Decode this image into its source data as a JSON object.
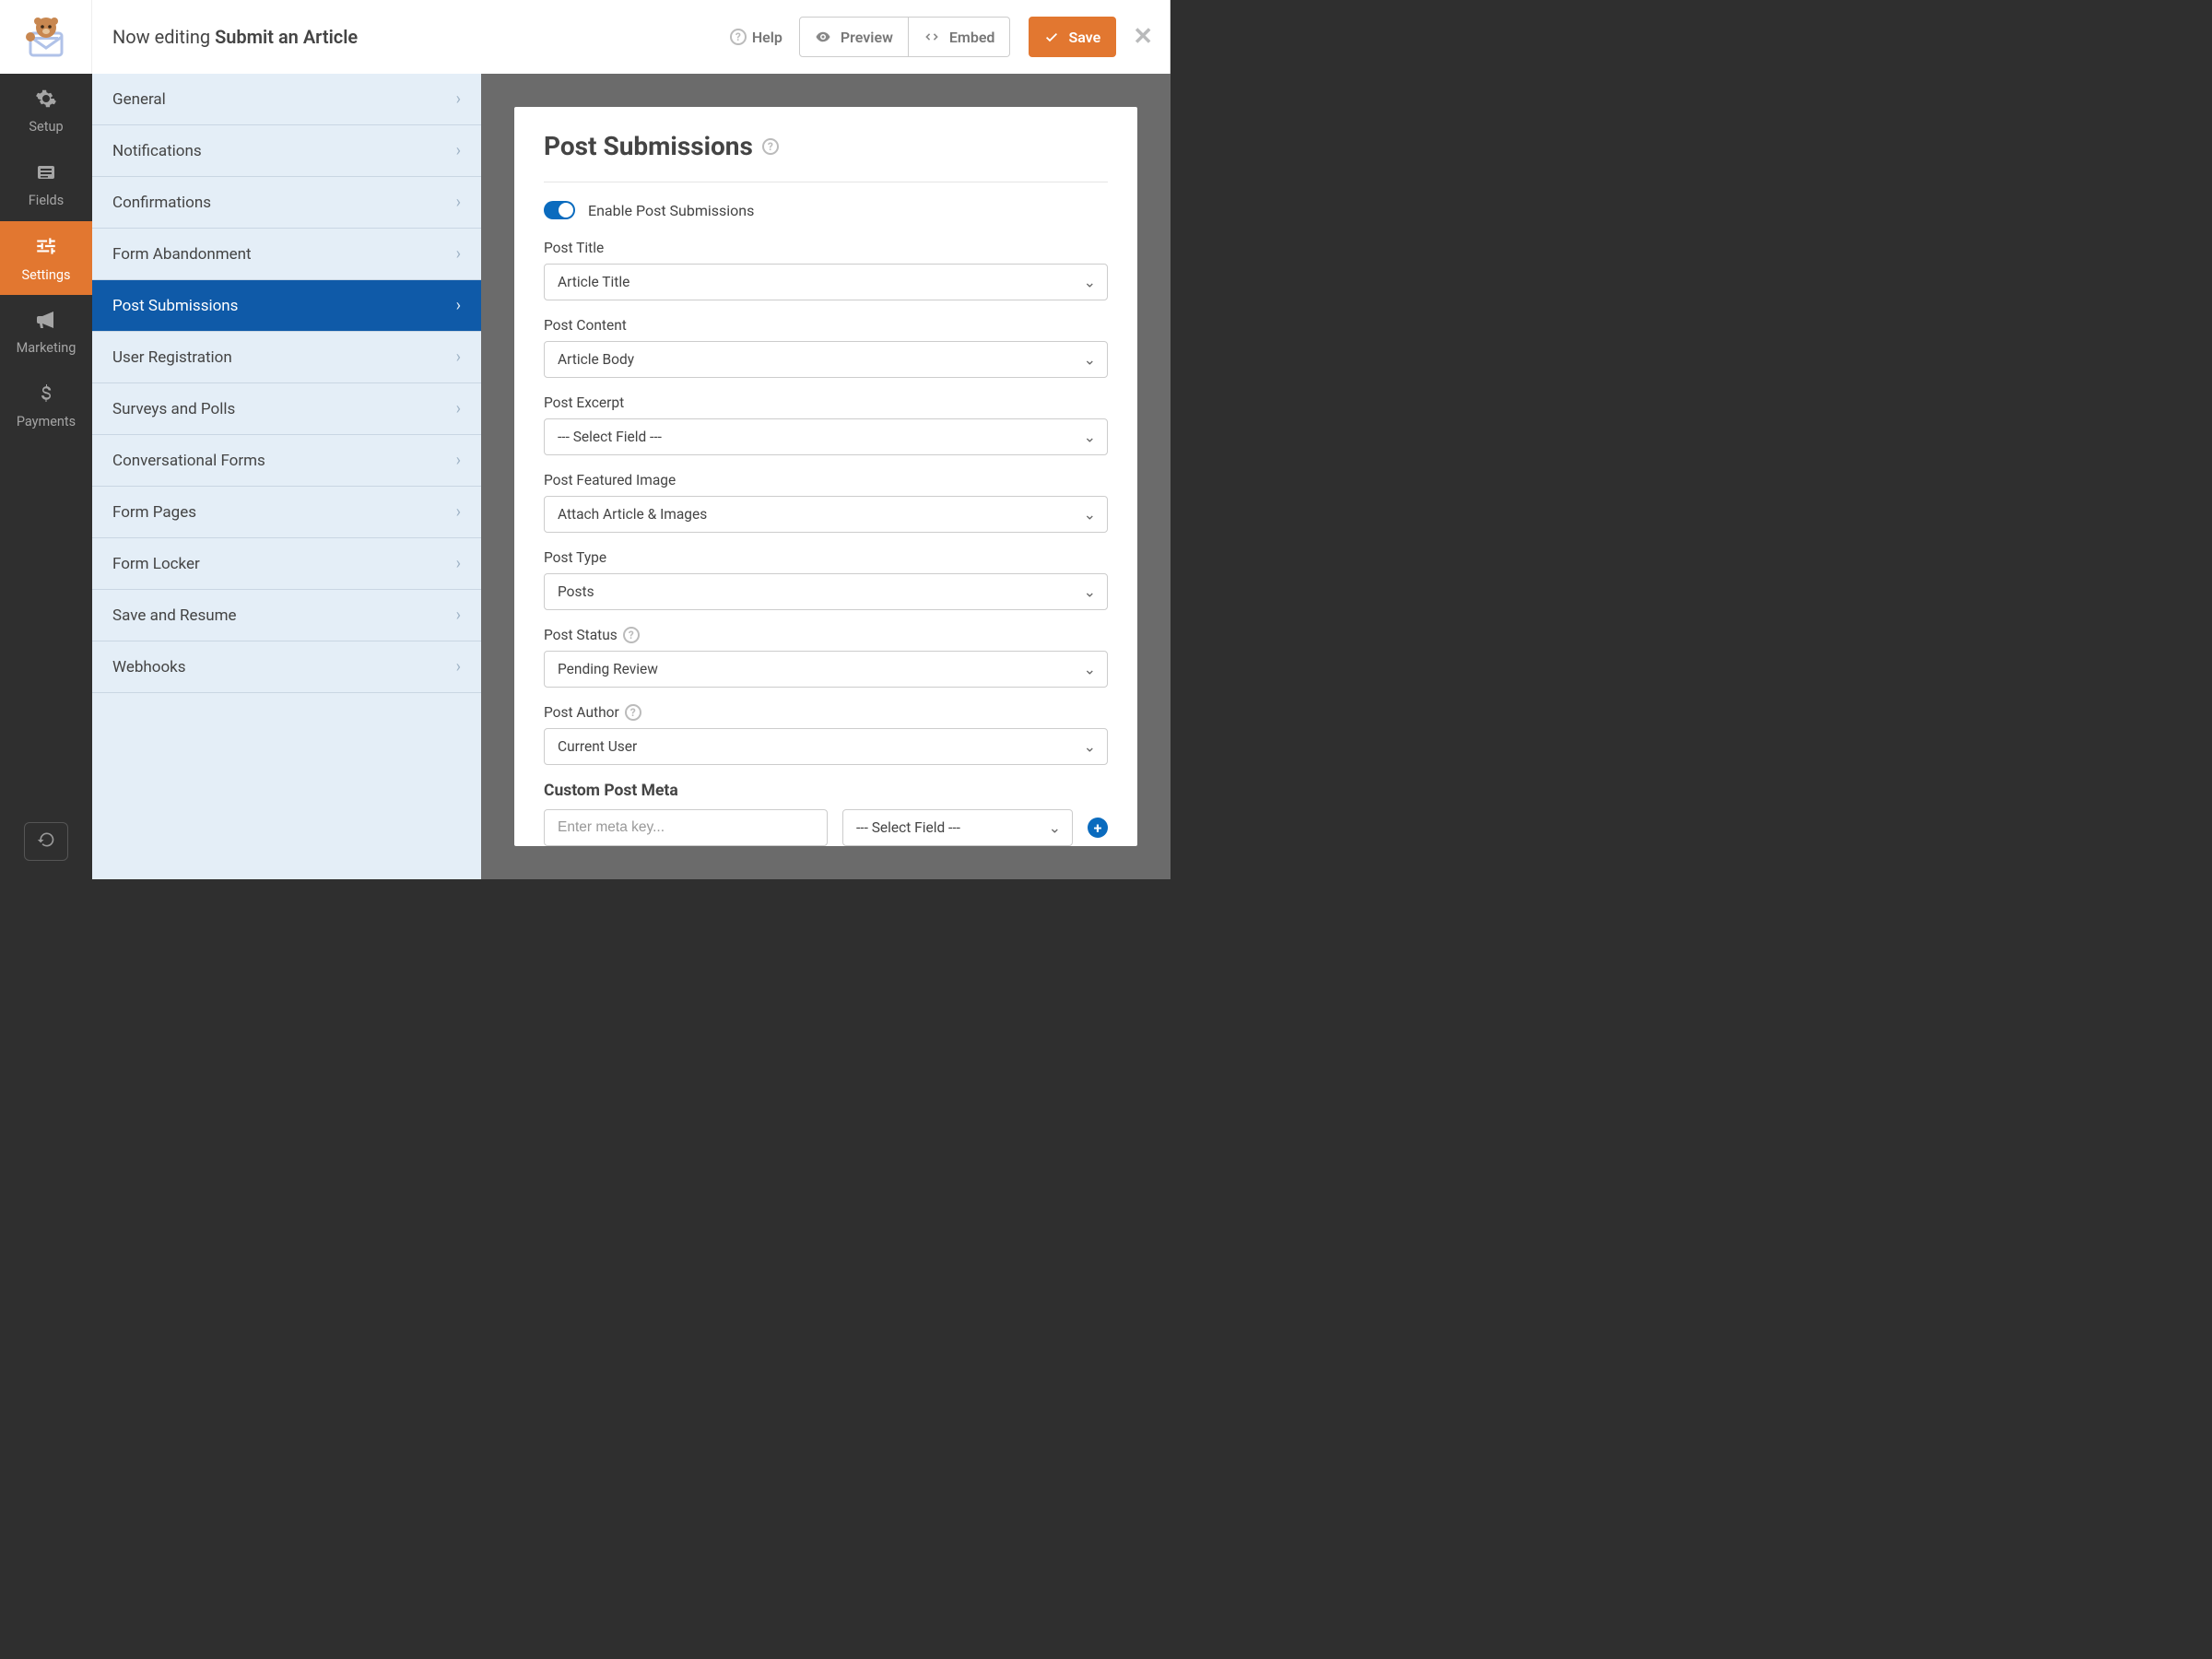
{
  "header": {
    "editing_prefix": "Now editing ",
    "form_title": "Submit an Article",
    "help": "Help",
    "preview": "Preview",
    "embed": "Embed",
    "save": "Save"
  },
  "leftnav": {
    "items": [
      {
        "label": "Setup"
      },
      {
        "label": "Fields"
      },
      {
        "label": "Settings"
      },
      {
        "label": "Marketing"
      },
      {
        "label": "Payments"
      }
    ],
    "active_index": 2
  },
  "settings_menu": {
    "items": [
      "General",
      "Notifications",
      "Confirmations",
      "Form Abandonment",
      "Post Submissions",
      "User Registration",
      "Surveys and Polls",
      "Conversational Forms",
      "Form Pages",
      "Form Locker",
      "Save and Resume",
      "Webhooks"
    ],
    "active_index": 4
  },
  "panel": {
    "title": "Post Submissions",
    "toggle_label": "Enable Post Submissions",
    "toggle_on": true,
    "fields": [
      {
        "label": "Post Title",
        "value": "Article Title",
        "help": false
      },
      {
        "label": "Post Content",
        "value": "Article Body",
        "help": false
      },
      {
        "label": "Post Excerpt",
        "value": "--- Select Field ---",
        "help": false
      },
      {
        "label": "Post Featured Image",
        "value": "Attach Article & Images",
        "help": false
      },
      {
        "label": "Post Type",
        "value": "Posts",
        "help": false
      },
      {
        "label": "Post Status",
        "value": "Pending Review",
        "help": true
      },
      {
        "label": "Post Author",
        "value": "Current User",
        "help": true
      }
    ],
    "custom_meta_heading": "Custom Post Meta",
    "custom_meta": {
      "key_placeholder": "Enter meta key...",
      "field_select": "--- Select Field ---"
    }
  }
}
